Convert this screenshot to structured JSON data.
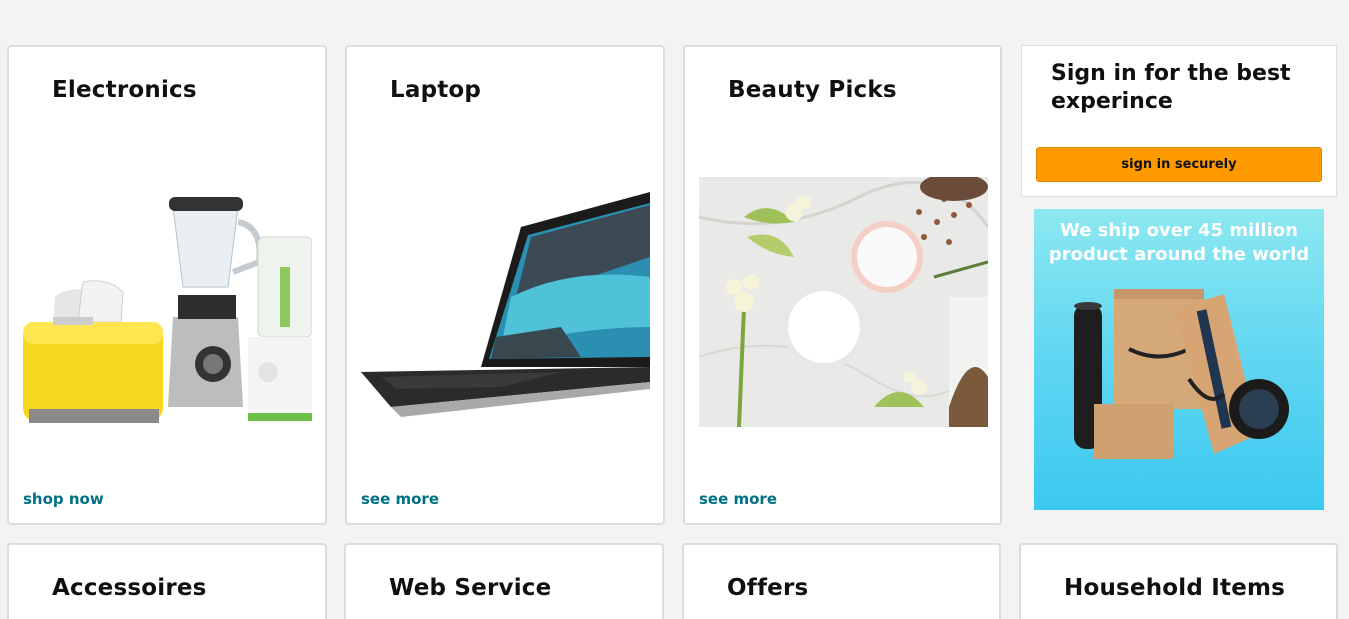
{
  "cards": {
    "electronics": {
      "title": "Electronics",
      "link": "shop now"
    },
    "laptop": {
      "title": "Laptop",
      "link": "see more"
    },
    "beauty": {
      "title": "Beauty Picks",
      "link": "see more"
    }
  },
  "signin": {
    "text": "Sign in for the best experince",
    "button_label": "sign in securely"
  },
  "ad": {
    "text": "We ship over 45 million product around the world"
  },
  "bottom_cards": {
    "accessoires": {
      "title": "Accessoires"
    },
    "webservice": {
      "title": "Web Service"
    },
    "offers": {
      "title": "Offers"
    },
    "household": {
      "title": "Household Items"
    }
  },
  "colors": {
    "accent_button": "#ff9900",
    "link": "#007185",
    "background": "#f3f3f3"
  }
}
